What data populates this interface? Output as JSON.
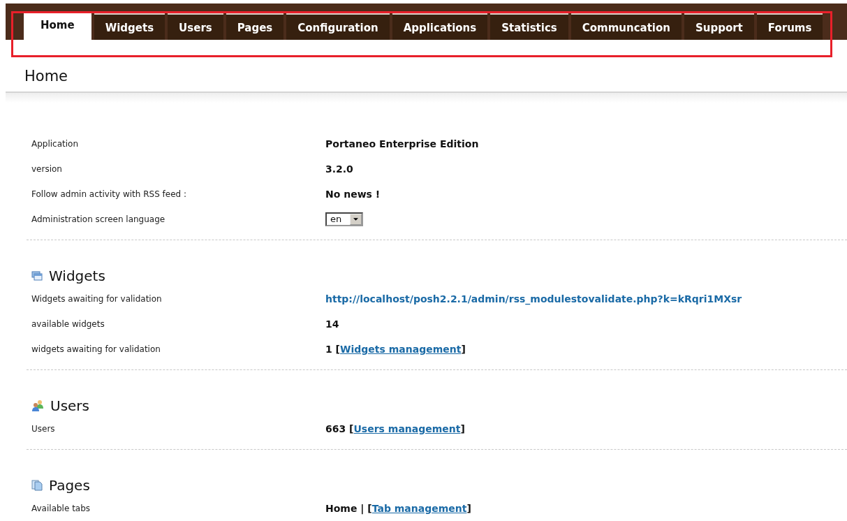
{
  "tabs": [
    {
      "label": "Home",
      "selected": true
    },
    {
      "label": "Widgets",
      "selected": false
    },
    {
      "label": "Users",
      "selected": false
    },
    {
      "label": "Pages",
      "selected": false
    },
    {
      "label": "Configuration",
      "selected": false
    },
    {
      "label": "Applications",
      "selected": false
    },
    {
      "label": "Statistics",
      "selected": false
    },
    {
      "label": "Communcation",
      "selected": false
    },
    {
      "label": "Support",
      "selected": false
    },
    {
      "label": "Forums",
      "selected": false
    }
  ],
  "page_title": "Home",
  "sections": [
    {
      "rows": [
        {
          "label": "Application",
          "kind": "text",
          "parts": [
            {
              "text": "Portaneo Enterprise Edition"
            }
          ]
        },
        {
          "label": "version",
          "kind": "text",
          "parts": [
            {
              "text": "3.2.0"
            }
          ]
        },
        {
          "label": "Follow admin activity with RSS feed :",
          "kind": "text",
          "parts": [
            {
              "text": "No news !"
            }
          ]
        },
        {
          "label": "Administration screen language",
          "kind": "select",
          "value": "en"
        }
      ]
    },
    {
      "title": "Widgets",
      "kind": "widgets",
      "rows": [
        {
          "label": "Widgets awaiting for validation",
          "kind": "url",
          "value": "http://localhost/posh2.2.1/admin/rss_modulestovalidate.php?k=kRqri1MXsr"
        },
        {
          "label": "available widgets",
          "kind": "text",
          "parts": [
            {
              "text": "14"
            }
          ]
        },
        {
          "label": "widgets awaiting for validation",
          "kind": "text",
          "parts": [
            {
              "text": "1 ["
            },
            {
              "link": "Widgets management"
            },
            {
              "text": "]"
            }
          ]
        }
      ]
    },
    {
      "title": "Users",
      "kind": "users",
      "rows": [
        {
          "label": "Users",
          "kind": "text",
          "parts": [
            {
              "text": "663 ["
            },
            {
              "link": "Users management"
            },
            {
              "text": "]"
            }
          ]
        }
      ]
    },
    {
      "title": "Pages",
      "kind": "pages",
      "rows": [
        {
          "label": "Available tabs",
          "kind": "text",
          "parts": [
            {
              "text": "Home | ["
            },
            {
              "link": "Tab management"
            },
            {
              "text": "]"
            }
          ]
        }
      ]
    }
  ]
}
